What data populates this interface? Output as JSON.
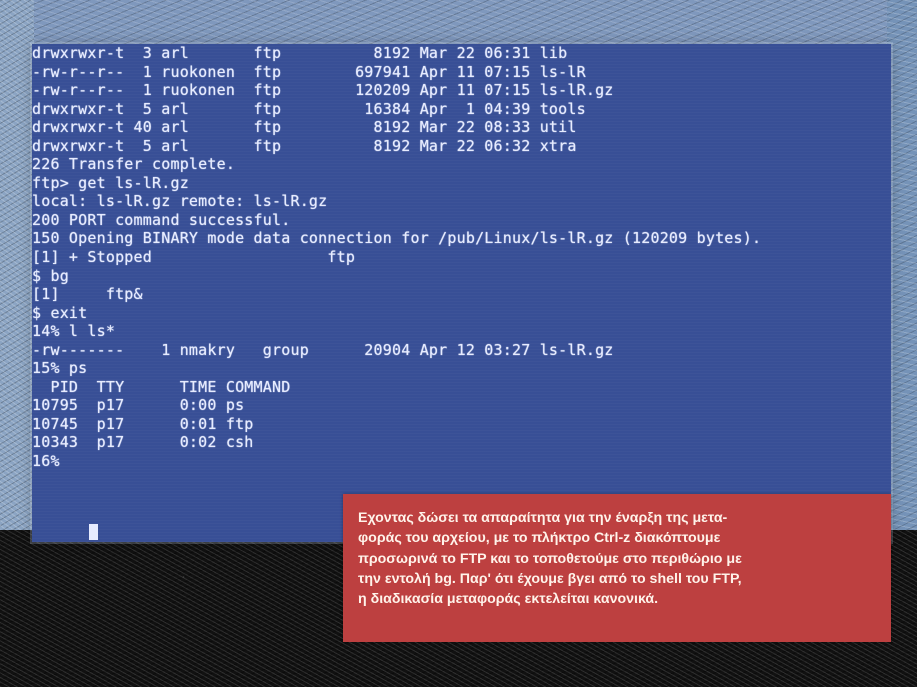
{
  "terminal": {
    "lines": [
      "drwxrwxr-t  3 arl       ftp          8192 Mar 22 06:31 lib",
      "-rw-r--r--  1 ruokonen  ftp        697941 Apr 11 07:15 ls-lR",
      "-rw-r--r--  1 ruokonen  ftp        120209 Apr 11 07:15 ls-lR.gz",
      "drwxrwxr-t  5 arl       ftp         16384 Apr  1 04:39 tools",
      "drwxrwxr-t 40 arl       ftp          8192 Mar 22 08:33 util",
      "drwxrwxr-t  5 arl       ftp          8192 Mar 22 06:32 xtra",
      "226 Transfer complete.",
      "ftp> get ls-lR.gz",
      "local: ls-lR.gz remote: ls-lR.gz",
      "200 PORT command successful.",
      "150 Opening BINARY mode data connection for /pub/Linux/ls-lR.gz (120209 bytes).",
      "[1] + Stopped                   ftp",
      "$ bg",
      "[1]     ftp&",
      "$ exit",
      "14% l ls*",
      "-rw-------    1 nmakry   group      20904 Apr 12 03:27 ls-lR.gz",
      "15% ps",
      "  PID  TTY      TIME COMMAND",
      "10795  p17      0:00 ps",
      "10745  p17      0:01 ftp",
      "10343  p17      0:02 csh",
      "16%"
    ]
  },
  "caption": {
    "lines": [
      "Εχοντας δώσει τα απαραίτητα για την έναρξη της μετα-",
      "φοράς του αρχείου, με το πλήκτρο Ctrl-z διακόπτουμε",
      "προσωρινά το FTP και το τοποθετούμε στο περιθώριο με",
      "την εντολή bg. Παρ' ότι έχουμε βγει από το shell του FTP,",
      "η διαδικασία μεταφοράς εκτελείται κανονικά."
    ]
  },
  "colors": {
    "terminal_background": "#384f96",
    "terminal_text": "#e7ecff",
    "caption_background": "#bd4040"
  }
}
